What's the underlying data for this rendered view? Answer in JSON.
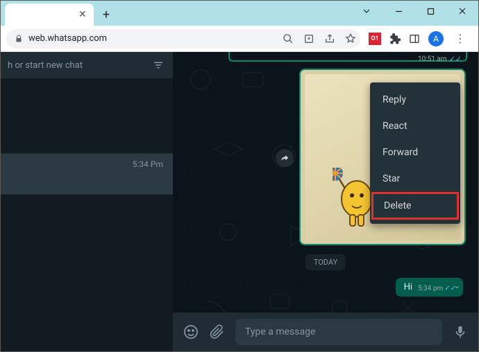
{
  "browser": {
    "url": "web.whatsapp.com",
    "avatar_letter": "A",
    "ext_label": "O1"
  },
  "sidebar": {
    "search_placeholder": "h or start new chat",
    "chat_time": "5:34 Pm"
  },
  "chat": {
    "prev_time": "10:51 am",
    "today_label": "TODAY",
    "hi_text": "Hi",
    "hi_time": "5:34 pm",
    "composer_placeholder": "Type a message"
  },
  "context_menu": {
    "items": [
      "Reply",
      "React",
      "Forward",
      "Star",
      "Delete"
    ],
    "highlighted_index": 4
  }
}
